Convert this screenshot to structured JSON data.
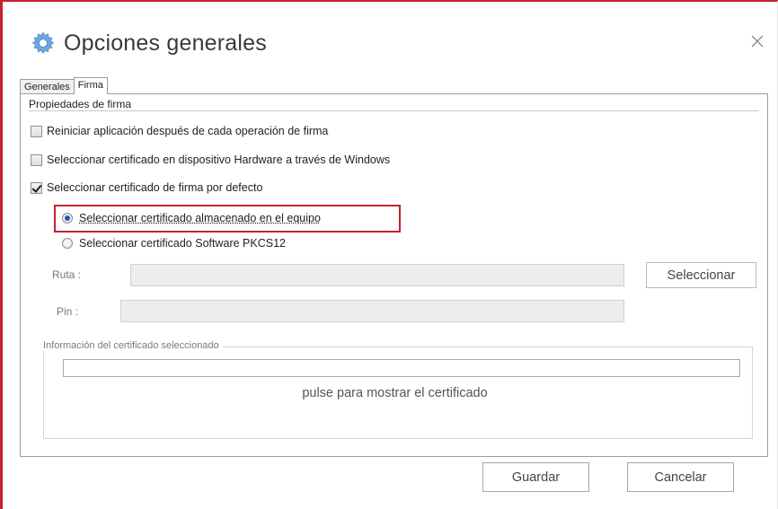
{
  "window": {
    "title": "Opciones generales",
    "close_glyph": "×"
  },
  "tabs": [
    {
      "label": "Generales",
      "active": false
    },
    {
      "label": "Firma",
      "active": true
    }
  ],
  "firma": {
    "group_title": "Propiedades de firma",
    "checkboxes": [
      {
        "label": "Reiniciar aplicación después de cada operación de firma",
        "checked": false
      },
      {
        "label": "Seleccionar certificado en dispositivo Hardware a través de Windows",
        "checked": false
      },
      {
        "label": "Seleccionar certificado de firma por defecto",
        "checked": true
      }
    ],
    "radios": [
      {
        "label": "Seleccionar certificado almacenado en el equipo",
        "selected": true
      },
      {
        "label": "Seleccionar certificado Software PKCS12",
        "selected": false
      }
    ],
    "ruta_label": "Ruta :",
    "ruta_value": "",
    "pin_label": "Pin :",
    "pin_value": "",
    "seleccionar_button": "Seleccionar",
    "cert_group_title": "Información del certificado seleccionado",
    "cert_value": "",
    "cert_link": "pulse para mostrar el certificado"
  },
  "footer": {
    "save_label": "Guardar",
    "cancel_label": "Cancelar"
  },
  "colors": {
    "highlight": "#c3222f",
    "window_accent": "#c8202c",
    "gear_icon": "#5b9bd5"
  },
  "icons": {
    "title_icon": "gear-icon",
    "close_icon": "close-icon"
  }
}
